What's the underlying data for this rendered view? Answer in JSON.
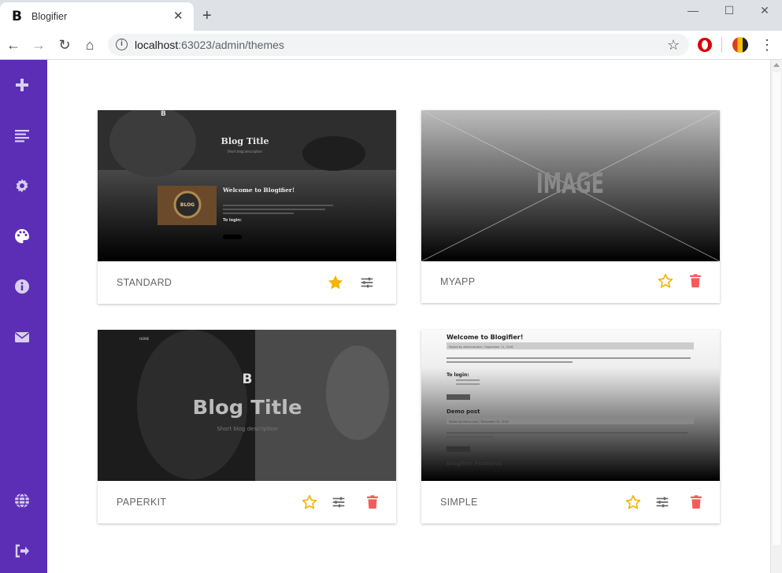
{
  "browser": {
    "tab_title": "Blogifier",
    "tab_favicon": "B",
    "url_host": "localhost",
    "url_rest": ":63023/admin/themes"
  },
  "sidebar": {
    "items": [
      {
        "icon": "plus-icon"
      },
      {
        "icon": "posts-list-icon"
      },
      {
        "icon": "gear-icon"
      },
      {
        "icon": "palette-icon"
      },
      {
        "icon": "info-icon"
      },
      {
        "icon": "envelope-icon"
      },
      {
        "icon": "globe-icon"
      },
      {
        "icon": "sign-out-icon"
      }
    ]
  },
  "themes": [
    {
      "name": "STANDARD",
      "is_active": true,
      "preview": {
        "title": "Blog Title",
        "subtitle": "Short blog description",
        "post_title": "Welcome to Blogifier!",
        "login_heading": "To login:",
        "badge": "BLOG"
      }
    },
    {
      "name": "MYAPP",
      "is_active": false,
      "preview": {
        "placeholder": "IMAGE"
      }
    },
    {
      "name": "PAPERKIT",
      "is_active": false,
      "preview": {
        "nav": "HOME",
        "logo": "B",
        "title": "Blog Title",
        "subtitle": "Short blog description"
      }
    },
    {
      "name": "SIMPLE",
      "is_active": false,
      "preview": {
        "post1_title": "Welcome to Blogifier!",
        "post1_meta": "Posted by Administrator / September 11, 2018",
        "login_heading": "To login:",
        "post2_title": "Demo post",
        "post2_meta": "Posted by Demo user / December 15, 2018",
        "post3_title": "Blogifier Features",
        "read_more": "Read more"
      }
    }
  ],
  "colors": {
    "sidebar": "#5c2db5",
    "star_active": "#f5b400",
    "star_outline": "#f5b400",
    "delete": "#f45b5b",
    "settings": "#666666"
  }
}
